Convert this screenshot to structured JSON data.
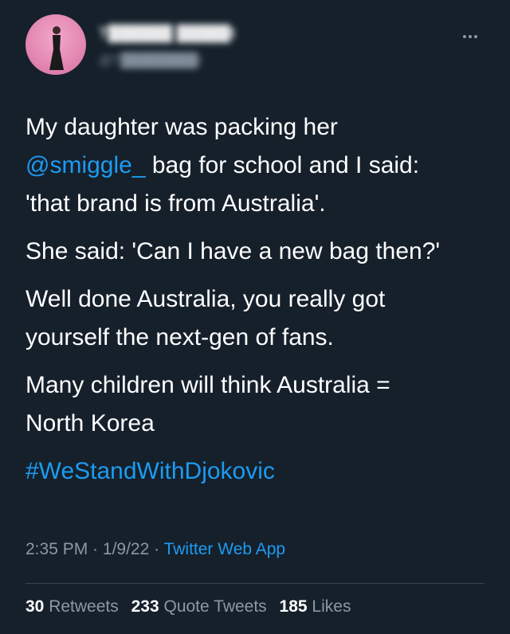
{
  "header": {
    "avatar_icon": "profile-photo",
    "display_name": "T██████ █████t",
    "handle": "@T████████t",
    "more_icon": "more-horizontal-icon"
  },
  "tweet": {
    "p1_before": "My daughter was packing her\n",
    "p1_mention": "@smiggle_",
    "p1_after": " bag for school and I said:\n'that brand is from Australia'.",
    "p2": "She said: 'Can I have a new bag then?'",
    "p3": "Well done Australia, you really got\nyourself the next-gen of fans.",
    "p4": "Many children will think Australia =\nNorth Korea",
    "hashtag": "#WeStandWithDjokovic"
  },
  "meta": {
    "time": "2:35 PM",
    "sep1": " · ",
    "date": "1/9/22",
    "sep2": " · ",
    "app": "Twitter Web App"
  },
  "stats": {
    "retweets_count": "30",
    "retweets_label": "Retweets",
    "quotes_count": "233",
    "quotes_label": "Quote Tweets",
    "likes_count": "185",
    "likes_label": "Likes"
  },
  "colors": {
    "background": "#15202b",
    "link": "#1d9bf0",
    "secondary_text": "#8b98a5",
    "divider": "#38444d"
  }
}
